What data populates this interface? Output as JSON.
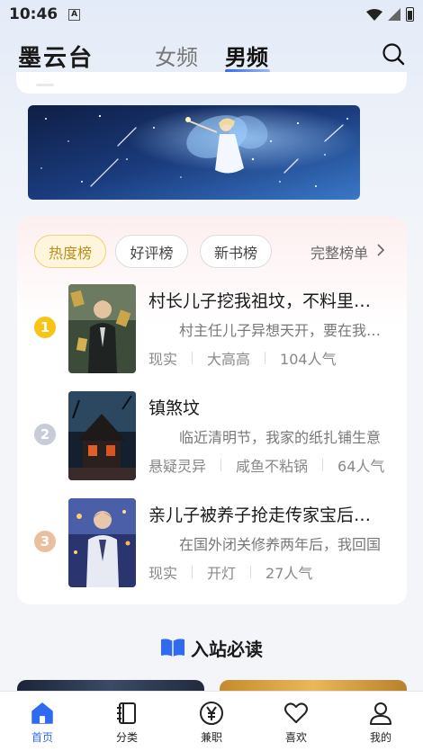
{
  "status_bar": {
    "time": "10:46",
    "notif_icon": "A"
  },
  "header": {
    "logo": "墨云台",
    "tabs": [
      {
        "label": "女频",
        "active": false
      },
      {
        "label": "男频",
        "active": true
      }
    ]
  },
  "ranking": {
    "chips": [
      {
        "label": "热度榜",
        "active": true
      },
      {
        "label": "好评榜",
        "active": false
      },
      {
        "label": "新书榜",
        "active": false
      }
    ],
    "full_list": "完整榜单",
    "books": [
      {
        "rank": "1",
        "rank_color": "#f6c515",
        "title": "村长儿子挖我祖坟，不料里面藏着",
        "desc": "村主任儿子异想天开，要在我家祖坟上",
        "meta": [
          "现实",
          "大高高",
          "104人气"
        ]
      },
      {
        "rank": "2",
        "rank_color": "#c7ccd6",
        "title": "镇煞坟",
        "desc": "临近清明节，我家的纸扎铺生意",
        "meta": [
          "悬疑灵异",
          "咸鱼不粘锅",
          "64人气"
        ]
      },
      {
        "rank": "3",
        "rank_color": "#eabf9e",
        "title": "亲儿子被养子抢走传家宝后悔疯了",
        "desc": "在国外闭关修养两年后，我回国",
        "meta": [
          "现实",
          "开灯",
          "27人气"
        ]
      }
    ]
  },
  "section": {
    "must_read": "入站必读"
  },
  "bottom_nav": [
    {
      "label": "首页",
      "icon": "home-icon",
      "active": true
    },
    {
      "label": "分类",
      "icon": "book-category-icon",
      "active": false
    },
    {
      "label": "兼职",
      "icon": "yen-coin-icon",
      "active": false
    },
    {
      "label": "喜欢",
      "icon": "heart-icon",
      "active": false
    },
    {
      "label": "我的",
      "icon": "user-icon",
      "active": false
    }
  ],
  "colors": {
    "accent": "#2f6bf2",
    "hot_chip_bg": "#fdf6dc",
    "hot_chip_text": "#bd8d1e"
  }
}
